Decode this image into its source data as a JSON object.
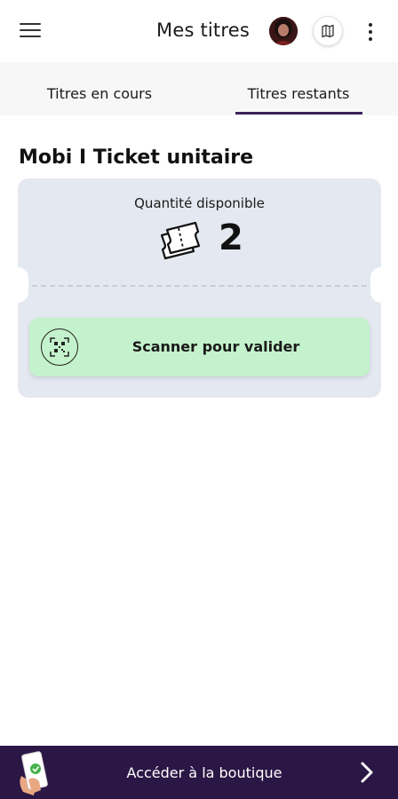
{
  "header": {
    "title": "Mes titres",
    "menu_icon": "hamburger-menu-icon",
    "avatar_icon": "user-avatar",
    "map_icon": "map-icon",
    "more_icon": "more-vertical-icon"
  },
  "tabs": [
    {
      "label": "Titres en cours",
      "active": false
    },
    {
      "label": "Titres restants",
      "active": true
    }
  ],
  "product": {
    "title": "Mobi I Ticket unitaire",
    "quantity_label": "Quantité disponible",
    "quantity_value": "2",
    "scan_label": "Scanner pour valider"
  },
  "footer": {
    "shop_label": "Accéder à la boutique"
  },
  "colors": {
    "accent": "#3a2358",
    "card_bg": "#e4e8f0",
    "scan_bg": "#c4f2cc",
    "footer_bg": "#2b1745"
  }
}
